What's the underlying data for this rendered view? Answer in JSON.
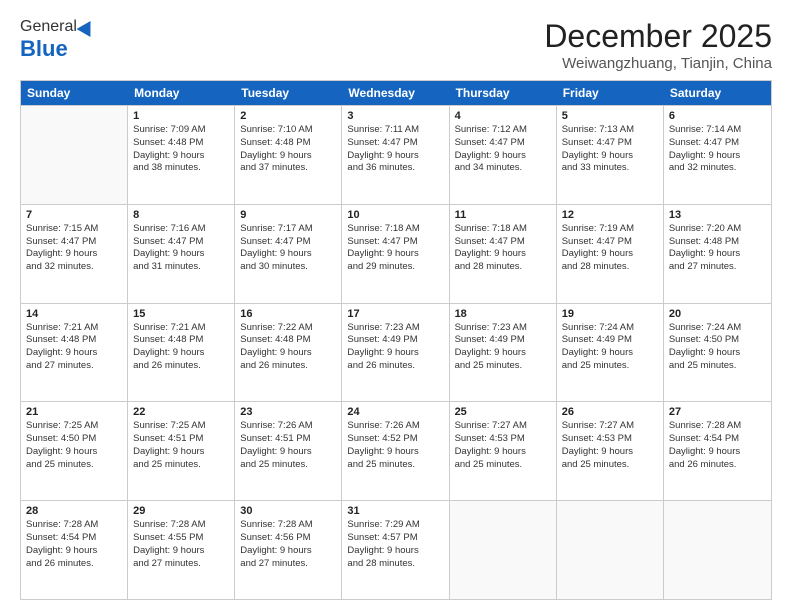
{
  "logo": {
    "line1": "General",
    "line2": "Blue"
  },
  "title": "December 2025",
  "subtitle": "Weiwangzhuang, Tianjin, China",
  "header_days": [
    "Sunday",
    "Monday",
    "Tuesday",
    "Wednesday",
    "Thursday",
    "Friday",
    "Saturday"
  ],
  "weeks": [
    [
      {
        "day": "",
        "sunrise": "",
        "sunset": "",
        "daylight": ""
      },
      {
        "day": "1",
        "sunrise": "Sunrise: 7:09 AM",
        "sunset": "Sunset: 4:48 PM",
        "daylight": "Daylight: 9 hours and 38 minutes."
      },
      {
        "day": "2",
        "sunrise": "Sunrise: 7:10 AM",
        "sunset": "Sunset: 4:48 PM",
        "daylight": "Daylight: 9 hours and 37 minutes."
      },
      {
        "day": "3",
        "sunrise": "Sunrise: 7:11 AM",
        "sunset": "Sunset: 4:47 PM",
        "daylight": "Daylight: 9 hours and 36 minutes."
      },
      {
        "day": "4",
        "sunrise": "Sunrise: 7:12 AM",
        "sunset": "Sunset: 4:47 PM",
        "daylight": "Daylight: 9 hours and 34 minutes."
      },
      {
        "day": "5",
        "sunrise": "Sunrise: 7:13 AM",
        "sunset": "Sunset: 4:47 PM",
        "daylight": "Daylight: 9 hours and 33 minutes."
      },
      {
        "day": "6",
        "sunrise": "Sunrise: 7:14 AM",
        "sunset": "Sunset: 4:47 PM",
        "daylight": "Daylight: 9 hours and 32 minutes."
      }
    ],
    [
      {
        "day": "7",
        "sunrise": "Sunrise: 7:15 AM",
        "sunset": "Sunset: 4:47 PM",
        "daylight": "Daylight: 9 hours and 32 minutes."
      },
      {
        "day": "8",
        "sunrise": "Sunrise: 7:16 AM",
        "sunset": "Sunset: 4:47 PM",
        "daylight": "Daylight: 9 hours and 31 minutes."
      },
      {
        "day": "9",
        "sunrise": "Sunrise: 7:17 AM",
        "sunset": "Sunset: 4:47 PM",
        "daylight": "Daylight: 9 hours and 30 minutes."
      },
      {
        "day": "10",
        "sunrise": "Sunrise: 7:18 AM",
        "sunset": "Sunset: 4:47 PM",
        "daylight": "Daylight: 9 hours and 29 minutes."
      },
      {
        "day": "11",
        "sunrise": "Sunrise: 7:18 AM",
        "sunset": "Sunset: 4:47 PM",
        "daylight": "Daylight: 9 hours and 28 minutes."
      },
      {
        "day": "12",
        "sunrise": "Sunrise: 7:19 AM",
        "sunset": "Sunset: 4:47 PM",
        "daylight": "Daylight: 9 hours and 28 minutes."
      },
      {
        "day": "13",
        "sunrise": "Sunrise: 7:20 AM",
        "sunset": "Sunset: 4:48 PM",
        "daylight": "Daylight: 9 hours and 27 minutes."
      }
    ],
    [
      {
        "day": "14",
        "sunrise": "Sunrise: 7:21 AM",
        "sunset": "Sunset: 4:48 PM",
        "daylight": "Daylight: 9 hours and 27 minutes."
      },
      {
        "day": "15",
        "sunrise": "Sunrise: 7:21 AM",
        "sunset": "Sunset: 4:48 PM",
        "daylight": "Daylight: 9 hours and 26 minutes."
      },
      {
        "day": "16",
        "sunrise": "Sunrise: 7:22 AM",
        "sunset": "Sunset: 4:48 PM",
        "daylight": "Daylight: 9 hours and 26 minutes."
      },
      {
        "day": "17",
        "sunrise": "Sunrise: 7:23 AM",
        "sunset": "Sunset: 4:49 PM",
        "daylight": "Daylight: 9 hours and 26 minutes."
      },
      {
        "day": "18",
        "sunrise": "Sunrise: 7:23 AM",
        "sunset": "Sunset: 4:49 PM",
        "daylight": "Daylight: 9 hours and 25 minutes."
      },
      {
        "day": "19",
        "sunrise": "Sunrise: 7:24 AM",
        "sunset": "Sunset: 4:49 PM",
        "daylight": "Daylight: 9 hours and 25 minutes."
      },
      {
        "day": "20",
        "sunrise": "Sunrise: 7:24 AM",
        "sunset": "Sunset: 4:50 PM",
        "daylight": "Daylight: 9 hours and 25 minutes."
      }
    ],
    [
      {
        "day": "21",
        "sunrise": "Sunrise: 7:25 AM",
        "sunset": "Sunset: 4:50 PM",
        "daylight": "Daylight: 9 hours and 25 minutes."
      },
      {
        "day": "22",
        "sunrise": "Sunrise: 7:25 AM",
        "sunset": "Sunset: 4:51 PM",
        "daylight": "Daylight: 9 hours and 25 minutes."
      },
      {
        "day": "23",
        "sunrise": "Sunrise: 7:26 AM",
        "sunset": "Sunset: 4:51 PM",
        "daylight": "Daylight: 9 hours and 25 minutes."
      },
      {
        "day": "24",
        "sunrise": "Sunrise: 7:26 AM",
        "sunset": "Sunset: 4:52 PM",
        "daylight": "Daylight: 9 hours and 25 minutes."
      },
      {
        "day": "25",
        "sunrise": "Sunrise: 7:27 AM",
        "sunset": "Sunset: 4:53 PM",
        "daylight": "Daylight: 9 hours and 25 minutes."
      },
      {
        "day": "26",
        "sunrise": "Sunrise: 7:27 AM",
        "sunset": "Sunset: 4:53 PM",
        "daylight": "Daylight: 9 hours and 25 minutes."
      },
      {
        "day": "27",
        "sunrise": "Sunrise: 7:28 AM",
        "sunset": "Sunset: 4:54 PM",
        "daylight": "Daylight: 9 hours and 26 minutes."
      }
    ],
    [
      {
        "day": "28",
        "sunrise": "Sunrise: 7:28 AM",
        "sunset": "Sunset: 4:54 PM",
        "daylight": "Daylight: 9 hours and 26 minutes."
      },
      {
        "day": "29",
        "sunrise": "Sunrise: 7:28 AM",
        "sunset": "Sunset: 4:55 PM",
        "daylight": "Daylight: 9 hours and 27 minutes."
      },
      {
        "day": "30",
        "sunrise": "Sunrise: 7:28 AM",
        "sunset": "Sunset: 4:56 PM",
        "daylight": "Daylight: 9 hours and 27 minutes."
      },
      {
        "day": "31",
        "sunrise": "Sunrise: 7:29 AM",
        "sunset": "Sunset: 4:57 PM",
        "daylight": "Daylight: 9 hours and 28 minutes."
      },
      {
        "day": "",
        "sunrise": "",
        "sunset": "",
        "daylight": ""
      },
      {
        "day": "",
        "sunrise": "",
        "sunset": "",
        "daylight": ""
      },
      {
        "day": "",
        "sunrise": "",
        "sunset": "",
        "daylight": ""
      }
    ]
  ]
}
